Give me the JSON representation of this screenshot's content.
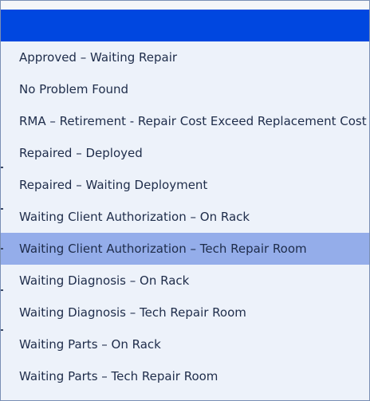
{
  "dropdown": {
    "selected_value": "",
    "options": [
      {
        "label": "Approved – Waiting Repair"
      },
      {
        "label": "No Problem Found"
      },
      {
        "label": "RMA – Retirement - Repair Cost Exceed Replacement Cost"
      },
      {
        "label": "Repaired – Deployed"
      },
      {
        "label": "Repaired – Waiting Deployment"
      },
      {
        "label": "Waiting Client Authorization – On Rack"
      },
      {
        "label": "Waiting Client Authorization – Tech Repair Room"
      },
      {
        "label": "Waiting Diagnosis – On Rack"
      },
      {
        "label": "Waiting Diagnosis – Tech Repair Room"
      },
      {
        "label": "Waiting Parts – On Rack"
      },
      {
        "label": "Waiting Parts – Tech Repair Room"
      }
    ],
    "highlighted_index": 6,
    "colors": {
      "selected_bar": "#0047e0",
      "highlight": "#94adea",
      "background": "#edf2fa",
      "text": "#1e2c4a"
    }
  }
}
